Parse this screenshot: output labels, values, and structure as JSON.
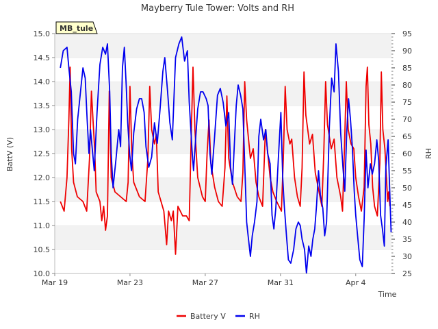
{
  "chart_data": {
    "type": "line",
    "title": "Mayberry Tule Tower: Volts and RH",
    "station_label": "MB_tule",
    "xlabel": "Time",
    "ylabel_left": "BattV (V)",
    "ylabel_right": "RH",
    "x_ticks": [
      "Mar 19",
      "Mar 23",
      "Mar 27",
      "Mar 31",
      "Apr 4"
    ],
    "x_tick_days": [
      0,
      4,
      8,
      12,
      16
    ],
    "xlim_days": [
      0,
      17.9
    ],
    "ylim_left": [
      10.0,
      15.0
    ],
    "y_ticks_left": [
      "10.0",
      "10.5",
      "11.0",
      "11.5",
      "12.0",
      "12.5",
      "13.0",
      "13.5",
      "14.0",
      "14.5",
      "15.0"
    ],
    "ylim_right": [
      25,
      95
    ],
    "y_ticks_right": [
      "25",
      "30",
      "35",
      "40",
      "45",
      "50",
      "55",
      "60",
      "65",
      "70",
      "75",
      "80",
      "85",
      "90",
      "95"
    ],
    "grid": "horizontal bands",
    "legend_position": "bottom",
    "series": [
      {
        "name": "Battery V",
        "axis": "left",
        "color": "#ee0000",
        "points": [
          [
            0.3,
            11.5
          ],
          [
            0.5,
            11.3
          ],
          [
            0.65,
            12.0
          ],
          [
            0.75,
            13.2
          ],
          [
            0.82,
            14.3
          ],
          [
            0.9,
            12.6
          ],
          [
            1.0,
            11.9
          ],
          [
            1.2,
            11.6
          ],
          [
            1.5,
            11.5
          ],
          [
            1.7,
            11.3
          ],
          [
            1.85,
            12.4
          ],
          [
            1.95,
            13.8
          ],
          [
            2.05,
            13.1
          ],
          [
            2.12,
            12.6
          ],
          [
            2.2,
            11.7
          ],
          [
            2.4,
            11.5
          ],
          [
            2.5,
            11.1
          ],
          [
            2.6,
            11.4
          ],
          [
            2.7,
            10.9
          ],
          [
            2.8,
            11.2
          ],
          [
            2.9,
            13.8
          ],
          [
            3.0,
            12.0
          ],
          [
            3.2,
            11.7
          ],
          [
            3.5,
            11.6
          ],
          [
            3.8,
            11.5
          ],
          [
            3.9,
            11.9
          ],
          [
            4.0,
            13.9
          ],
          [
            4.1,
            12.5
          ],
          [
            4.2,
            11.9
          ],
          [
            4.5,
            11.6
          ],
          [
            4.8,
            11.5
          ],
          [
            4.95,
            12.4
          ],
          [
            5.05,
            13.9
          ],
          [
            5.15,
            13.0
          ],
          [
            5.3,
            12.7
          ],
          [
            5.4,
            12.9
          ],
          [
            5.5,
            11.7
          ],
          [
            5.65,
            11.5
          ],
          [
            5.8,
            11.3
          ],
          [
            5.95,
            10.6
          ],
          [
            6.05,
            11.3
          ],
          [
            6.2,
            11.1
          ],
          [
            6.3,
            11.3
          ],
          [
            6.42,
            10.4
          ],
          [
            6.55,
            11.4
          ],
          [
            6.8,
            11.2
          ],
          [
            7.0,
            11.2
          ],
          [
            7.15,
            11.1
          ],
          [
            7.25,
            12.8
          ],
          [
            7.35,
            14.3
          ],
          [
            7.45,
            13.0
          ],
          [
            7.6,
            12.0
          ],
          [
            7.85,
            11.6
          ],
          [
            8.0,
            11.5
          ],
          [
            8.1,
            12.5
          ],
          [
            8.2,
            13.2
          ],
          [
            8.3,
            12.3
          ],
          [
            8.5,
            11.8
          ],
          [
            8.7,
            11.5
          ],
          [
            8.9,
            11.4
          ],
          [
            9.05,
            12.2
          ],
          [
            9.15,
            13.7
          ],
          [
            9.25,
            12.4
          ],
          [
            9.45,
            11.9
          ],
          [
            9.7,
            11.6
          ],
          [
            9.9,
            11.5
          ],
          [
            10.0,
            12.1
          ],
          [
            10.1,
            14.0
          ],
          [
            10.2,
            13.2
          ],
          [
            10.4,
            12.4
          ],
          [
            10.55,
            12.6
          ],
          [
            10.7,
            11.9
          ],
          [
            10.85,
            11.6
          ],
          [
            11.05,
            11.4
          ],
          [
            11.2,
            13.0
          ],
          [
            11.3,
            12.6
          ],
          [
            11.45,
            12.0
          ],
          [
            11.6,
            11.7
          ],
          [
            11.8,
            11.5
          ],
          [
            12.05,
            11.3
          ],
          [
            12.15,
            12.4
          ],
          [
            12.25,
            13.9
          ],
          [
            12.35,
            13.0
          ],
          [
            12.5,
            12.7
          ],
          [
            12.6,
            12.8
          ],
          [
            12.75,
            12.0
          ],
          [
            12.9,
            11.6
          ],
          [
            13.05,
            11.4
          ],
          [
            13.15,
            12.2
          ],
          [
            13.25,
            14.2
          ],
          [
            13.35,
            13.3
          ],
          [
            13.55,
            12.7
          ],
          [
            13.7,
            12.9
          ],
          [
            13.85,
            12.1
          ],
          [
            14.05,
            11.7
          ],
          [
            14.2,
            11.4
          ],
          [
            14.3,
            12.5
          ],
          [
            14.4,
            14.0
          ],
          [
            14.5,
            13.1
          ],
          [
            14.7,
            12.6
          ],
          [
            14.85,
            12.8
          ],
          [
            15.0,
            12.0
          ],
          [
            15.2,
            11.6
          ],
          [
            15.3,
            11.3
          ],
          [
            15.4,
            12.6
          ],
          [
            15.5,
            14.0
          ],
          [
            15.6,
            13.0
          ],
          [
            15.75,
            12.7
          ],
          [
            15.9,
            12.6
          ],
          [
            16.0,
            12.0
          ],
          [
            16.15,
            11.6
          ],
          [
            16.3,
            11.3
          ],
          [
            16.45,
            11.8
          ],
          [
            16.55,
            13.9
          ],
          [
            16.62,
            14.3
          ],
          [
            16.7,
            13.1
          ],
          [
            16.8,
            12.7
          ],
          [
            16.9,
            11.8
          ],
          [
            17.0,
            11.4
          ],
          [
            17.15,
            11.2
          ],
          [
            17.28,
            12.3
          ],
          [
            17.36,
            14.2
          ],
          [
            17.44,
            13.0
          ],
          [
            17.55,
            12.6
          ],
          [
            17.7,
            11.5
          ],
          [
            17.75,
            11.7
          ],
          [
            17.82,
            11.4
          ]
        ]
      },
      {
        "name": "RH",
        "axis": "right",
        "color": "#0000ee",
        "points": [
          [
            0.3,
            85
          ],
          [
            0.45,
            90
          ],
          [
            0.65,
            91
          ],
          [
            0.75,
            85
          ],
          [
            0.88,
            78
          ],
          [
            1.0,
            60
          ],
          [
            1.1,
            57
          ],
          [
            1.22,
            70
          ],
          [
            1.35,
            77
          ],
          [
            1.5,
            85
          ],
          [
            1.62,
            82
          ],
          [
            1.72,
            70
          ],
          [
            1.82,
            60
          ],
          [
            1.9,
            67
          ],
          [
            2.0,
            61
          ],
          [
            2.1,
            55
          ],
          [
            2.25,
            72
          ],
          [
            2.4,
            86
          ],
          [
            2.55,
            91
          ],
          [
            2.7,
            89
          ],
          [
            2.8,
            92
          ],
          [
            2.92,
            78
          ],
          [
            3.0,
            60
          ],
          [
            3.1,
            50
          ],
          [
            3.25,
            58
          ],
          [
            3.4,
            67
          ],
          [
            3.5,
            62
          ],
          [
            3.6,
            85
          ],
          [
            3.7,
            91
          ],
          [
            3.8,
            80
          ],
          [
            3.88,
            69
          ],
          [
            3.98,
            60
          ],
          [
            4.08,
            55
          ],
          [
            4.2,
            66
          ],
          [
            4.35,
            73
          ],
          [
            4.5,
            76
          ],
          [
            4.62,
            76
          ],
          [
            4.75,
            72
          ],
          [
            4.85,
            62
          ],
          [
            5.0,
            56
          ],
          [
            5.15,
            59
          ],
          [
            5.3,
            69
          ],
          [
            5.45,
            63
          ],
          [
            5.6,
            73
          ],
          [
            5.75,
            84
          ],
          [
            5.85,
            88
          ],
          [
            6.0,
            78
          ],
          [
            6.12,
            69
          ],
          [
            6.25,
            64
          ],
          [
            6.42,
            88
          ],
          [
            6.6,
            92
          ],
          [
            6.75,
            94
          ],
          [
            6.9,
            87
          ],
          [
            7.05,
            90
          ],
          [
            7.15,
            75
          ],
          [
            7.3,
            61
          ],
          [
            7.38,
            55
          ],
          [
            7.5,
            65
          ],
          [
            7.6,
            73
          ],
          [
            7.75,
            78
          ],
          [
            7.88,
            78
          ],
          [
            8.05,
            76
          ],
          [
            8.15,
            74
          ],
          [
            8.25,
            60
          ],
          [
            8.35,
            54
          ],
          [
            8.5,
            65
          ],
          [
            8.65,
            77
          ],
          [
            8.8,
            79
          ],
          [
            8.95,
            75
          ],
          [
            9.1,
            68
          ],
          [
            9.25,
            72
          ],
          [
            9.35,
            56
          ],
          [
            9.45,
            51
          ],
          [
            9.55,
            63
          ],
          [
            9.65,
            74
          ],
          [
            9.75,
            80
          ],
          [
            9.88,
            77
          ],
          [
            10.0,
            73
          ],
          [
            10.1,
            57
          ],
          [
            10.2,
            40
          ],
          [
            10.3,
            35
          ],
          [
            10.4,
            30
          ],
          [
            10.5,
            36
          ],
          [
            10.62,
            40
          ],
          [
            10.75,
            46
          ],
          [
            10.85,
            65
          ],
          [
            10.95,
            70
          ],
          [
            11.1,
            64
          ],
          [
            11.22,
            67
          ],
          [
            11.32,
            60
          ],
          [
            11.45,
            57
          ],
          [
            11.55,
            42
          ],
          [
            11.65,
            38
          ],
          [
            11.75,
            44
          ],
          [
            11.9,
            60
          ],
          [
            12.02,
            72
          ],
          [
            12.12,
            53
          ],
          [
            12.2,
            45
          ],
          [
            12.32,
            36
          ],
          [
            12.42,
            29
          ],
          [
            12.55,
            28
          ],
          [
            12.7,
            32
          ],
          [
            12.82,
            38
          ],
          [
            12.95,
            40
          ],
          [
            13.05,
            39
          ],
          [
            13.15,
            35
          ],
          [
            13.28,
            32
          ],
          [
            13.38,
            25
          ],
          [
            13.5,
            33
          ],
          [
            13.62,
            30
          ],
          [
            13.72,
            35
          ],
          [
            13.82,
            38
          ],
          [
            13.92,
            45
          ],
          [
            14.02,
            55
          ],
          [
            14.12,
            48
          ],
          [
            14.25,
            44
          ],
          [
            14.35,
            36
          ],
          [
            14.45,
            40
          ],
          [
            14.6,
            68
          ],
          [
            14.72,
            82
          ],
          [
            14.85,
            78
          ],
          [
            14.95,
            92
          ],
          [
            15.08,
            84
          ],
          [
            15.2,
            66
          ],
          [
            15.32,
            56
          ],
          [
            15.42,
            49
          ],
          [
            15.52,
            66
          ],
          [
            15.62,
            76
          ],
          [
            15.72,
            70
          ],
          [
            15.82,
            62
          ],
          [
            15.92,
            49
          ],
          [
            16.0,
            42
          ],
          [
            16.1,
            36
          ],
          [
            16.22,
            29
          ],
          [
            16.35,
            27
          ],
          [
            16.45,
            41
          ],
          [
            16.55,
            61
          ],
          [
            16.65,
            50
          ],
          [
            16.78,
            57
          ],
          [
            16.88,
            54
          ],
          [
            17.0,
            57
          ],
          [
            17.12,
            64
          ],
          [
            17.22,
            58
          ],
          [
            17.32,
            42
          ],
          [
            17.42,
            38
          ],
          [
            17.52,
            33
          ],
          [
            17.6,
            56
          ],
          [
            17.72,
            64
          ],
          [
            17.8,
            50
          ],
          [
            17.88,
            37
          ]
        ]
      }
    ]
  }
}
